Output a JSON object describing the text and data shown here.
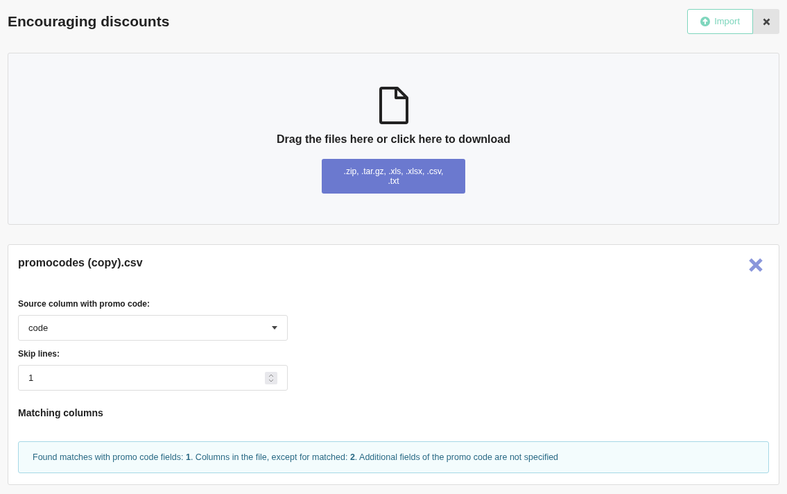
{
  "page": {
    "title": "Encouraging discounts"
  },
  "header_buttons": {
    "import": "Import"
  },
  "dropzone": {
    "message": "Drag the files here or click here to download",
    "formats_button": ".zip, .tar.gz, .xls, .xlsx, .csv, .txt"
  },
  "file_card": {
    "file_name": "promocodes (copy).csv",
    "source_column": {
      "label": "Source column with promo code:",
      "value": "code"
    },
    "skip_lines": {
      "label": "Skip lines:",
      "value": "1"
    },
    "section_title": "Matching columns",
    "alert": "Found matches with promo code fields: **1**. Columns in the file, except for matched: **2**. Additional fields of the promo code are not specified"
  }
}
